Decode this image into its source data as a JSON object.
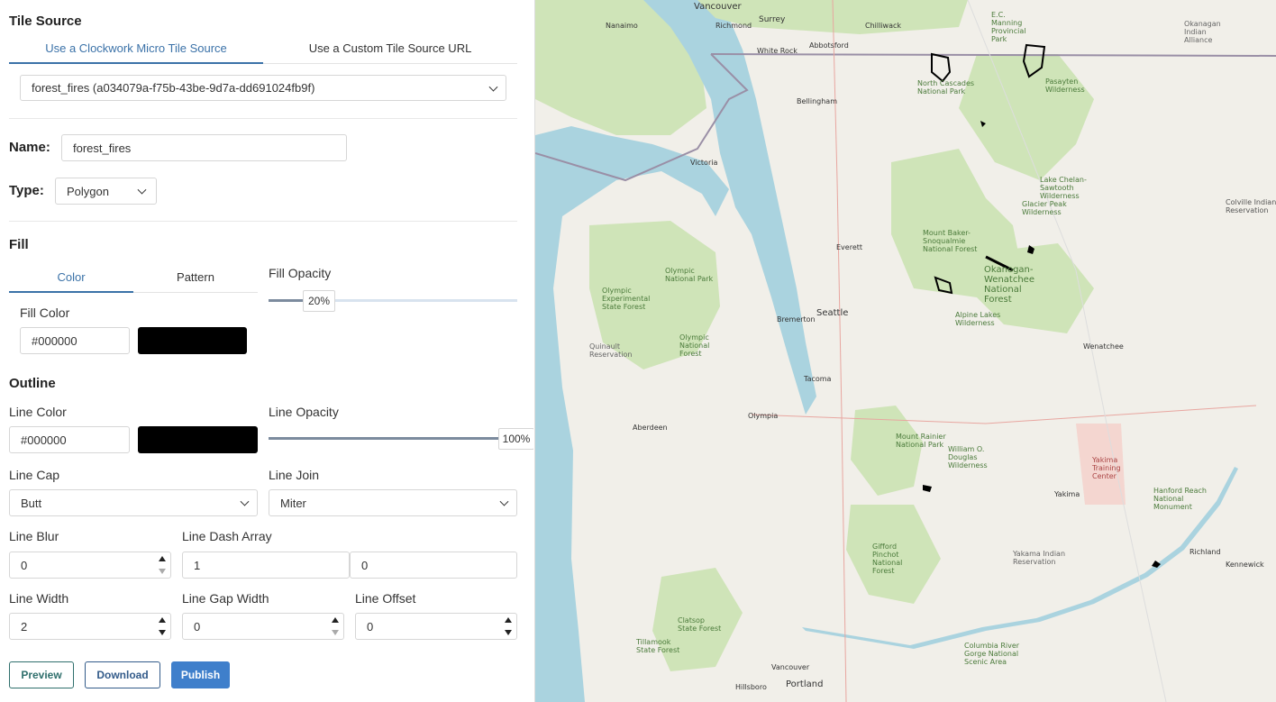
{
  "tile_source": {
    "title": "Tile Source",
    "tabs": [
      "Use a Clockwork Micro Tile Source",
      "Use a Custom Tile Source URL"
    ],
    "active_tab": 0,
    "selected_source": "forest_fires (a034079a-f75b-43be-9d7a-dd691024fb9f)"
  },
  "name": {
    "label": "Name:",
    "value": "forest_fires"
  },
  "type": {
    "label": "Type:",
    "value": "Polygon"
  },
  "fill": {
    "title": "Fill",
    "tabs": [
      "Color",
      "Pattern"
    ],
    "active_tab": 0,
    "color_label": "Fill Color",
    "color_value": "#000000",
    "swatch_color": "#000000",
    "opacity_label": "Fill Opacity",
    "opacity_value": "20%",
    "opacity_fraction": 0.2
  },
  "outline": {
    "title": "Outline",
    "color_label": "Line Color",
    "color_value": "#000000",
    "swatch_color": "#000000",
    "opacity_label": "Line Opacity",
    "opacity_value": "100%",
    "opacity_fraction": 1.0,
    "cap_label": "Line Cap",
    "cap_value": "Butt",
    "join_label": "Line Join",
    "join_value": "Miter",
    "blur_label": "Line Blur",
    "blur_value": "0",
    "dash_label": "Line Dash Array",
    "dash_values": [
      "1",
      "0"
    ],
    "width_label": "Line Width",
    "width_value": "2",
    "gap_label": "Line Gap Width",
    "gap_value": "0",
    "offset_label": "Line Offset",
    "offset_value": "0"
  },
  "actions": {
    "preview": "Preview",
    "download": "Download",
    "publish": "Publish"
  },
  "map": {
    "labels": {
      "vancouver": "Vancouver",
      "surrey": "Surrey",
      "richmond": "Richmond",
      "abbotsford": "Abbotsford",
      "chilliwack": "Chilliwack",
      "nanaimo": "Nanaimo",
      "white_rock": "White Rock",
      "bellingham": "Bellingham",
      "victoria": "Victoria",
      "north_cascades": "North Cascades National Park",
      "pasayten": "Pasayten Wilderness",
      "glacier_peak": "Glacier Peak Wilderness",
      "lake_chelan": "Lake Chelan-Sawtooth Wilderness",
      "colville": "Colville Indian Reservation",
      "everett": "Everett",
      "olympic_np": "Olympic National Park",
      "mbs": "Mount Baker-Snoqualmie National Forest",
      "okanogan": "Okanogan-Wenatchee National Forest",
      "seattle": "Seattle",
      "bremerton": "Bremerton",
      "alpine_lakes": "Alpine Lakes Wilderness",
      "olympic_nf": "Olympic National Forest",
      "wenatchee": "Wenatchee",
      "tacoma": "Tacoma",
      "olympia": "Olympia",
      "aberdeen": "Aberdeen",
      "quinault": "Quinault Reservation",
      "mt_rainier": "Mount Rainier National Park",
      "wod": "William O. Douglas Wilderness",
      "yakima_tc": "Yakima Training Center",
      "yakima": "Yakima",
      "hanford": "Hanford Reach National Monument",
      "gifford": "Gifford Pinchot National Forest",
      "yakama": "Yakama Indian Reservation",
      "richland": "Richland",
      "kennewick": "Kennewick",
      "vancouver_wa": "Vancouver",
      "portland": "Portland",
      "hillsboro": "Hillsboro",
      "columbia_gorge": "Columbia River Gorge National Scenic Area",
      "tillamook": "Tillamook State Forest",
      "elatsop": "Clatsop State Forest",
      "olympic_esf": "Olympic Experimental State Forest",
      "manning": "E.C. Manning Provincial Park",
      "okanagan_alliance": "Okanagan Indian Alliance"
    }
  }
}
